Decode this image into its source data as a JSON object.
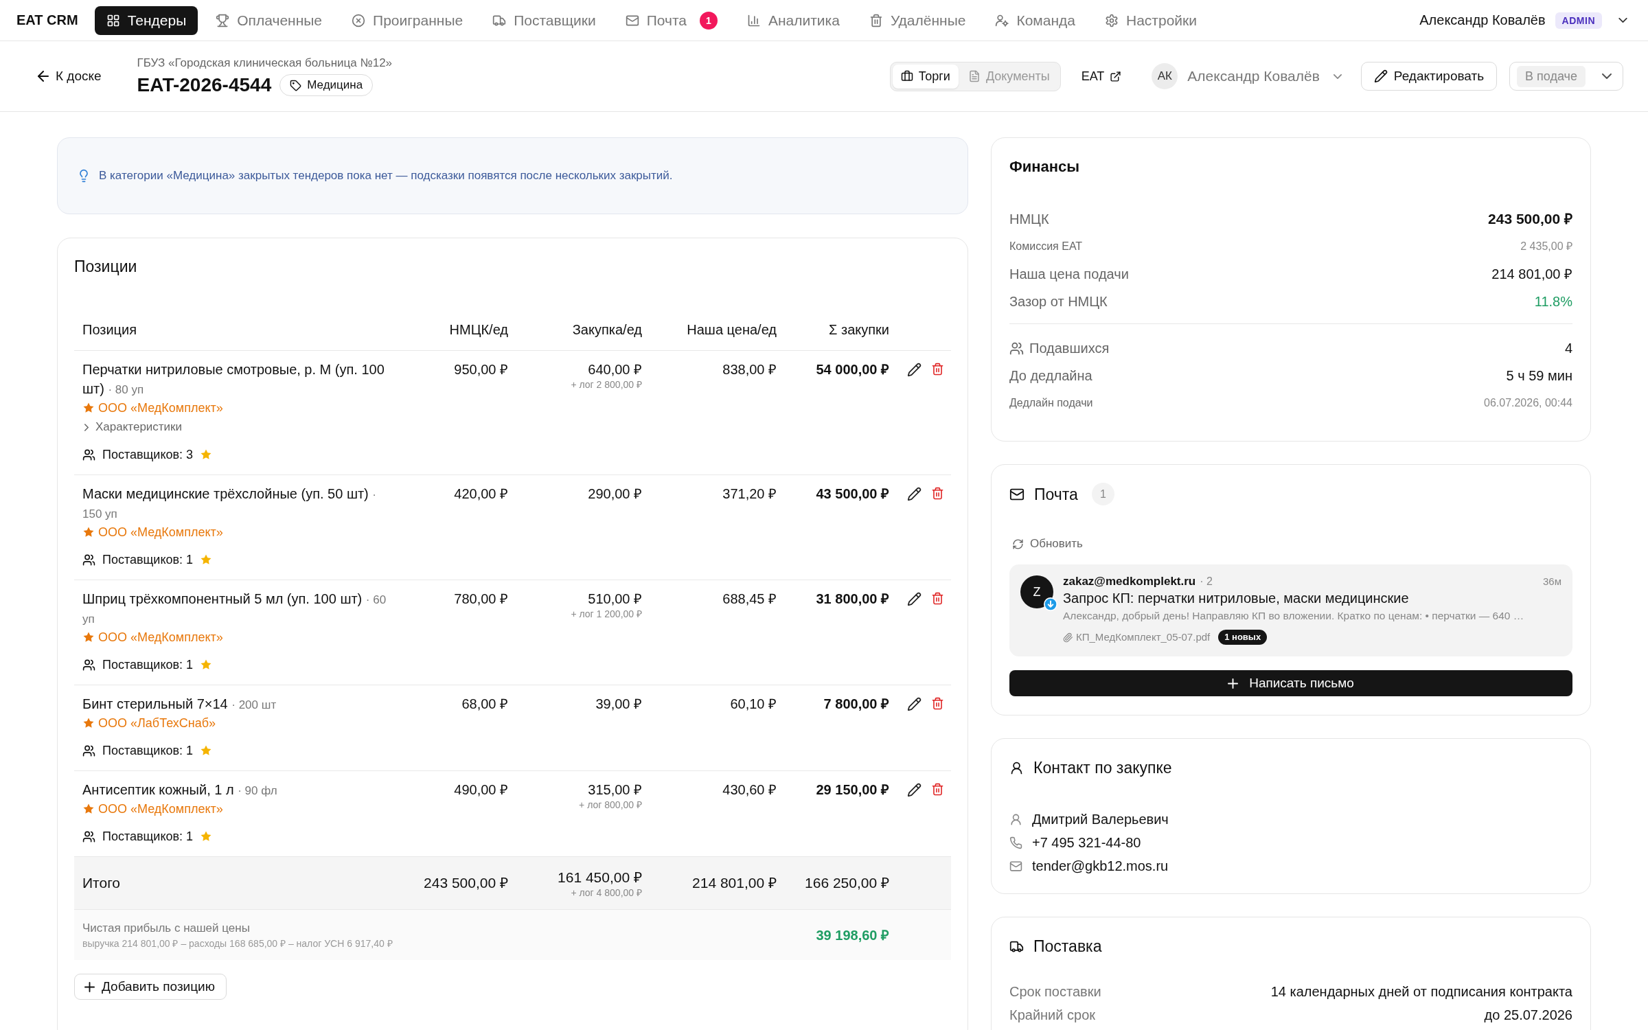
{
  "nav": {
    "logo": "EAT CRM",
    "items": [
      {
        "label": "Тендеры",
        "selected": true
      },
      {
        "label": "Оплаченные",
        "selected": false
      },
      {
        "label": "Проигранные",
        "selected": false
      },
      {
        "label": "Поставщики",
        "selected": false
      },
      {
        "label": "Почта",
        "selected": false,
        "badge": "1"
      },
      {
        "label": "Аналитика",
        "selected": false
      },
      {
        "label": "Удалённые",
        "selected": false
      },
      {
        "label": "Команда",
        "selected": false
      },
      {
        "label": "Настройки",
        "selected": false
      }
    ],
    "user": {
      "name": "Александр Ковалёв",
      "role": "ADMIN"
    }
  },
  "header": {
    "back": "К доске",
    "customer": "ГБУЗ «Городская клиническая больница №12»",
    "number": "EAT-2026-4544",
    "tag": "Медицина",
    "view_tabs": [
      {
        "label": "Торги",
        "selected": true
      },
      {
        "label": "Документы",
        "selected": false
      }
    ],
    "platform_link": "EAT",
    "assignee": {
      "initials": "АК",
      "name": "Александр Ковалёв"
    },
    "edit_button": "Редактировать",
    "status": "В подаче"
  },
  "hint": "В категории «Медицина» закрытых тендеров пока нет — подсказки появятся после нескольких закрытий.",
  "positions": {
    "title": "Позиции",
    "columns": [
      "Позиция",
      "НМЦК/ед",
      "Закупка/ед",
      "Наша цена/ед",
      "Σ закупки"
    ],
    "rows": [
      {
        "name": "Перчатки нитриловые смотровые, р. M (уп. 100 шт)",
        "quantity": "· 80 уп",
        "supplier": "ООО «МедКомплект»",
        "details": {
          "label": "Характеристики",
          "expanded": false
        },
        "unit_nmck": "950,00 ₽",
        "unit_purchase": "640,00 ₽",
        "logistics": "+ лог 2 800,00 ₽",
        "unit_price": "838,00 ₽",
        "purchase_total": "54 000,00 ₽",
        "suppliers": "Поставщиков: 3"
      },
      {
        "name": "Маски медицинские трёхслойные (уп. 50 шт)",
        "quantity": "· 150 уп",
        "supplier": "ООО «МедКомплект»",
        "unit_nmck": "420,00 ₽",
        "unit_purchase": "290,00 ₽",
        "unit_price": "371,20 ₽",
        "purchase_total": "43 500,00 ₽",
        "suppliers": "Поставщиков: 1"
      },
      {
        "name": "Шприц трёхкомпонентный 5 мл (уп. 100 шт)",
        "quantity": "· 60 уп",
        "supplier": "ООО «МедКомплект»",
        "unit_nmck": "780,00 ₽",
        "unit_purchase": "510,00 ₽",
        "logistics": "+ лог 1 200,00 ₽",
        "unit_price": "688,45 ₽",
        "purchase_total": "31 800,00 ₽",
        "suppliers": "Поставщиков: 1"
      },
      {
        "name": "Бинт стерильный 7×14",
        "quantity": "· 200 шт",
        "supplier": "ООО «ЛабТехСнаб»",
        "unit_nmck": "68,00 ₽",
        "unit_purchase": "39,00 ₽",
        "unit_price": "60,10 ₽",
        "purchase_total": "7 800,00 ₽",
        "suppliers": "Поставщиков: 1"
      },
      {
        "name": "Антисептик кожный, 1 л",
        "quantity": "· 90 фл",
        "supplier": "ООО «МедКомплект»",
        "unit_nmck": "490,00 ₽",
        "unit_purchase": "315,00 ₽",
        "logistics": "+ лог 800,00 ₽",
        "unit_price": "430,60 ₽",
        "purchase_total": "29 150,00 ₽",
        "suppliers": "Поставщиков: 1"
      }
    ],
    "total": {
      "label": "Итого",
      "nmck": "243 500,00 ₽",
      "purchase": "161 450,00 ₽",
      "logistics": "+ лог 4 800,00 ₽",
      "price": "214 801,00 ₽",
      "purchase_total": "166 250,00 ₽"
    },
    "profit": {
      "label": "Чистая прибыль с нашей цены",
      "breakdown": "выручка 214 801,00 ₽ – расходы 168 685,00 ₽ – налог УСН 6 917,40 ₽",
      "value": "39 198,60 ₽"
    },
    "add_button": "Добавить позицию"
  },
  "finances": {
    "title": "Финансы",
    "sections": [
      {
        "rows": [
          {
            "kind": "primary",
            "label": "НМЦК",
            "value": "243 500,00 ₽"
          },
          {
            "kind": "secondary",
            "label": "Комиссия EAT",
            "value": "2 435,00 ₽"
          },
          {
            "kind": "regular",
            "label": "Наша цена подачи",
            "value": "214 801,00 ₽"
          },
          {
            "kind": "positive",
            "label": "Зазор от НМЦК",
            "value": "11.8%"
          }
        ]
      },
      {
        "rows": [
          {
            "kind": "participants",
            "label": "Подавшихся",
            "value": "4"
          },
          {
            "kind": "regular",
            "label": "До дедлайна",
            "value": "5 ч 59 мин"
          },
          {
            "kind": "secondary",
            "label": "Дедлайн подачи",
            "value": "06.07.2026, 00:44"
          }
        ]
      }
    ]
  },
  "mail": {
    "title": "Почта",
    "count": "1",
    "refresh": "Обновить",
    "messages": [
      {
        "avatar": "Z",
        "from": "zakaz@medkomplekt.ru",
        "thread": "· 2",
        "time": "36м",
        "subject": "Запрос КП: перчатки нитриловые, маски медицинские",
        "preview": "Александр, добрый день! Направляю КП во вложении. Кратко по ценам: • перчатки — 640 …",
        "attachment": "КП_МедКомплект_05-07.pdf",
        "new_badge": "1 новых"
      }
    ],
    "compose_button": "Написать письмо"
  },
  "contact": {
    "title": "Контакт по закупке",
    "name": "Дмитрий Валерьевич",
    "phone": "+7 495 321-44-80",
    "email": "tender@gkb12.mos.ru"
  },
  "delivery": {
    "title": "Поставка",
    "rows": [
      {
        "label": "Срок поставки",
        "value": "14 календарных дней от подписания контракта"
      },
      {
        "label": "Крайний срок",
        "value": "до 25.07.2026"
      }
    ]
  }
}
